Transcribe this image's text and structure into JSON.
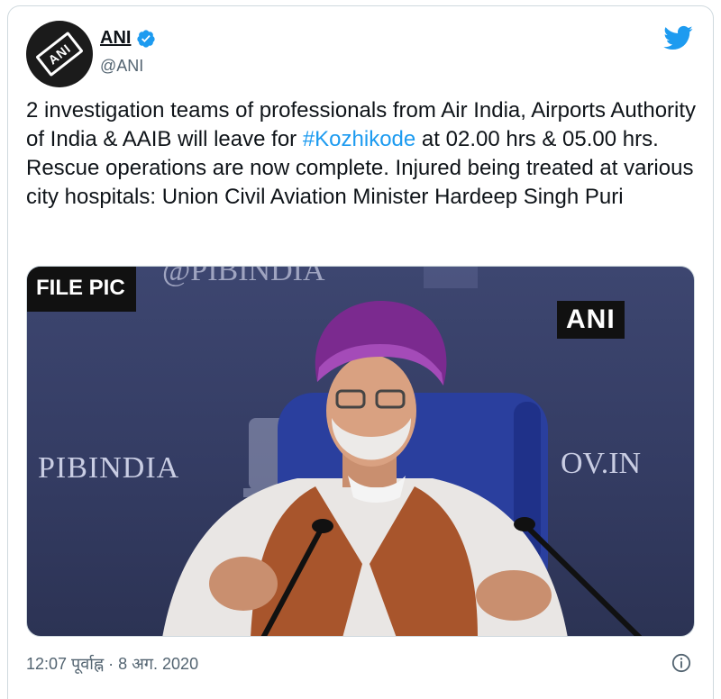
{
  "tweet": {
    "display_name": "ANI",
    "handle": "@ANI",
    "avatar_text": "ANI",
    "text_before": "2 investigation teams of professionals from Air India, Airports Authority of India & AAIB will leave for ",
    "hashtag": "#Kozhikode",
    "text_after": " at 02.00 hrs & 05.00 hrs. Rescue operations are now complete. Injured being treated at various city hospitals: Union Civil Aviation Minister Hardeep Singh Puri",
    "timestamp": "12:07 पूर्वाह्न · 8 अग. 2020"
  },
  "media": {
    "overlay_label": "FILE PIC",
    "watermark": "ANI",
    "background_texts": {
      "left": "PIBINDIA",
      "right": "OV.IN",
      "top": "@PIBINDIA"
    }
  },
  "icons": {
    "verified": "verified-badge-icon",
    "brand": "twitter-bird-icon",
    "info": "info-icon"
  },
  "colors": {
    "accent": "#1d9bf0",
    "text": "#0f1419",
    "muted": "#536471",
    "turban": "#7b2a8f",
    "vest": "#a8552c"
  }
}
